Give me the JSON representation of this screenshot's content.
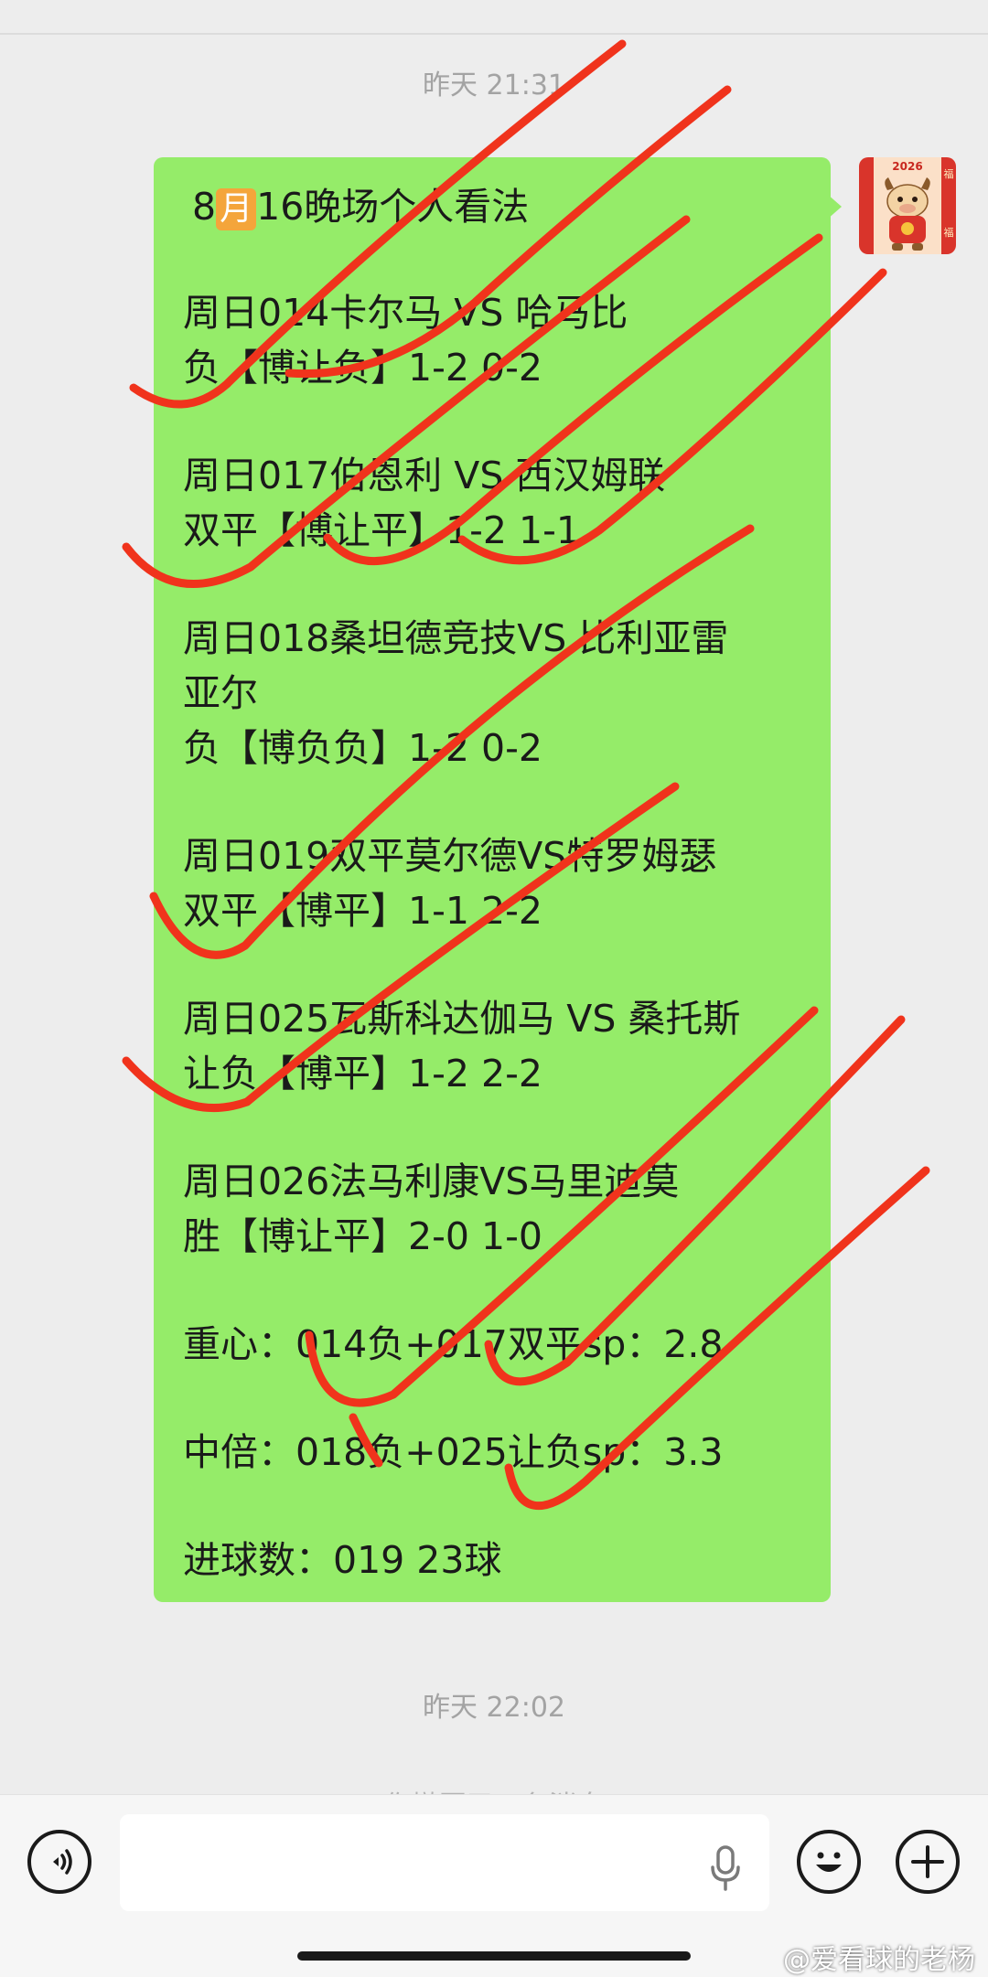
{
  "chat": {
    "timestamp_1": "昨天 21:31",
    "timestamp_2": "昨天 22:02",
    "recalled_notice": "你撤回了一条消息"
  },
  "message": {
    "title_prefix": "8",
    "title_month": "月",
    "title_suffix": "16晚场个人看法",
    "lines": [
      "周日014卡尔马 VS 哈马比",
      "负【博让负】1-2  0-2",
      "周日017伯恩利 VS 西汉姆联",
      "双平【博让平】1-2  1-1",
      "周日018桑坦德竞技VS 比利亚雷",
      "亚尔",
      "负【博负负】1-2  0-2",
      "周日019双平莫尔德VS特罗姆瑟",
      "双平【博平】1-1  2-2",
      "周日025瓦斯科达伽马 VS 桑托斯",
      "让负【博平】1-2  2-2",
      "周日026法马利康VS马里迪莫",
      "胜【博让平】2-0  1-0",
      "重心：014负+017双平sp：2.8",
      "中倍：018负+025让负sp：3.3",
      "进球数：019  23球"
    ]
  },
  "avatar": {
    "year_text": "2026",
    "fu_char": "福"
  },
  "input_bar": {
    "voice_icon": "voice-wave-icon",
    "mic_icon": "microphone-icon",
    "emoji_icon": "smiley-icon",
    "plus_icon": "plus-icon",
    "placeholder": ""
  },
  "watermark": "@爱看球的老杨",
  "colors": {
    "bubble": "#95ec69",
    "background": "#ededed",
    "check_marks": "#f0331c"
  }
}
